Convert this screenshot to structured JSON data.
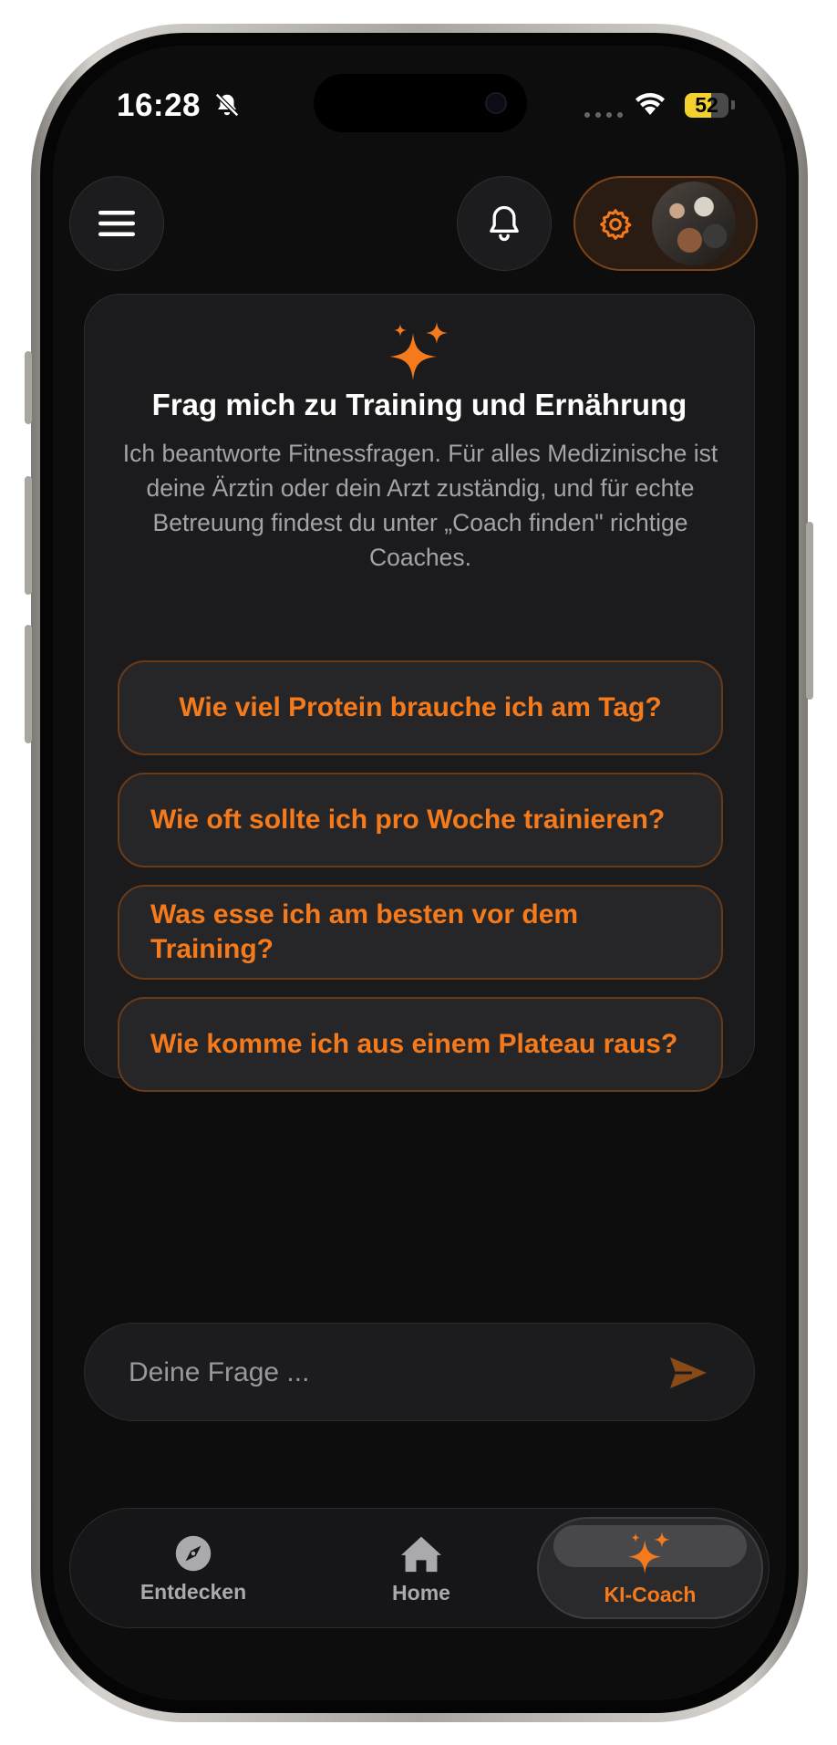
{
  "status_bar": {
    "time": "16:28",
    "battery": "52"
  },
  "header": {
    "menu_icon": "hamburger-icon",
    "notification_icon": "bell-icon",
    "settings_icon": "gear-icon"
  },
  "intro": {
    "icon": "sparkles-icon",
    "title": "Frag mich zu Training und Ernährung",
    "description": "Ich beantworte Fitnessfragen. Für alles Medizinische ist deine Ärztin oder dein Arzt zuständig, und für echte Betreuung findest du unter „Coach finden\" richtige Coaches."
  },
  "suggestions": [
    "Wie viel Protein brauche ich am Tag?",
    "Wie oft sollte ich pro Woche trainieren?",
    "Was esse ich am besten vor dem Training?",
    "Wie komme ich aus einem Plateau raus?"
  ],
  "input": {
    "placeholder": "Deine Frage ...",
    "send_icon": "send-icon"
  },
  "tab_bar": {
    "active": "KI-Coach",
    "tabs": [
      {
        "label": "Entdecken",
        "icon": "compass-icon"
      },
      {
        "label": "Home",
        "icon": "house-icon"
      },
      {
        "label": "KI-Coach",
        "icon": "sparkles-icon"
      }
    ]
  },
  "colors": {
    "accent": "#f47a1c",
    "background": "#0d0d0d",
    "card": "#1b1b1d",
    "suggestion_border": "#6b3a16",
    "battery": "#f5d12e"
  }
}
